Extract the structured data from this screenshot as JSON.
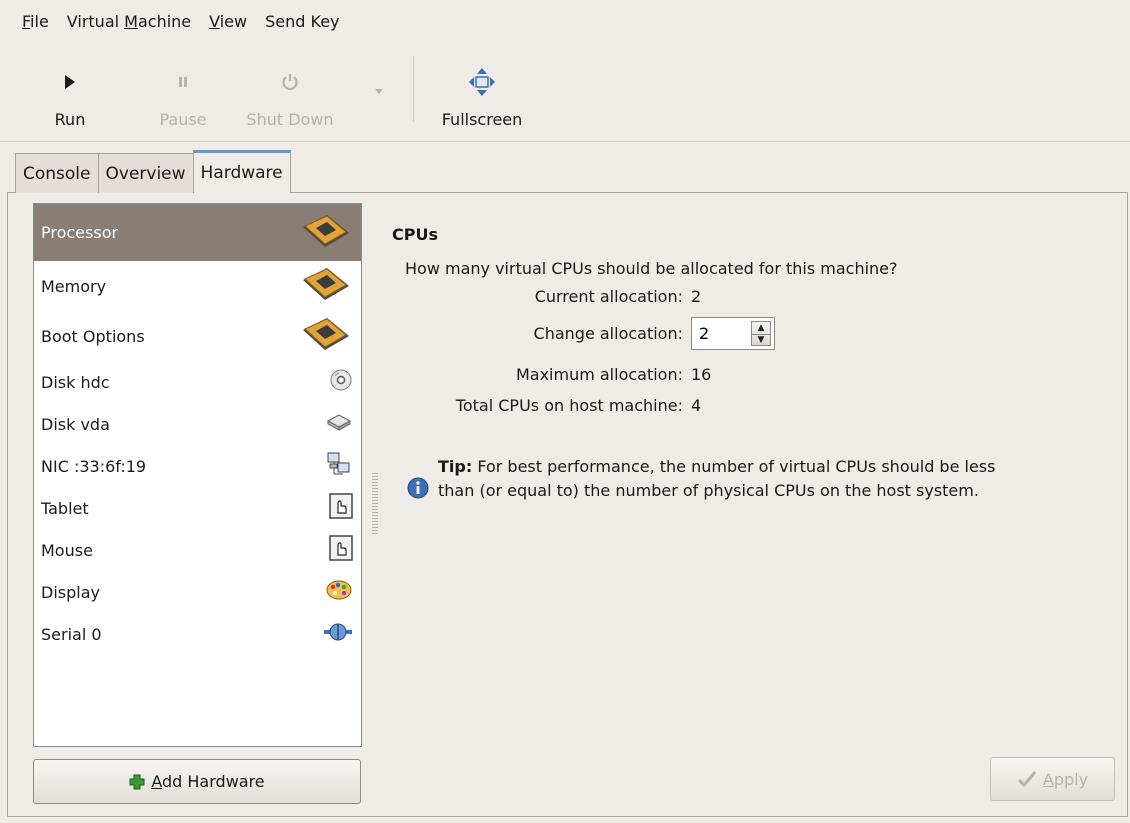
{
  "menu": [
    {
      "pre": "",
      "u": "F",
      "post": "ile"
    },
    {
      "pre": "Virtual ",
      "u": "M",
      "post": "achine"
    },
    {
      "pre": "",
      "u": "V",
      "post": "iew"
    },
    {
      "pre": "Send Key",
      "u": "",
      "post": ""
    }
  ],
  "toolbar": {
    "run": "Run",
    "pause": "Pause",
    "shutdown": "Shut Down",
    "fullscreen": "Fullscreen"
  },
  "tabs": [
    "Console",
    "Overview",
    "Hardware"
  ],
  "hardware_list": [
    {
      "label": "Processor",
      "icon": "chip-icon"
    },
    {
      "label": "Memory",
      "icon": "chip-icon"
    },
    {
      "label": "Boot Options",
      "icon": "chip-icon"
    },
    {
      "label": "Disk hdc",
      "icon": "cdrom-icon"
    },
    {
      "label": "Disk vda",
      "icon": "harddisk-icon"
    },
    {
      "label": "NIC :33:6f:19",
      "icon": "network-icon"
    },
    {
      "label": "Tablet",
      "icon": "tablet-icon"
    },
    {
      "label": "Mouse",
      "icon": "mouse-icon"
    },
    {
      "label": "Display",
      "icon": "palette-icon"
    },
    {
      "label": "Serial 0",
      "icon": "serial-icon"
    }
  ],
  "cpu": {
    "section_title": "CPUs",
    "question": "How many virtual CPUs should be allocated for this machine?",
    "current_label": "Current allocation:",
    "current_value": "2",
    "change_label": "Change allocation:",
    "change_value": "2",
    "max_label": "Maximum allocation:",
    "max_value": "16",
    "total_label": "Total CPUs on host machine:",
    "total_value": "4",
    "tip_bold": "Tip:",
    "tip_text": " For best performance, the number of virtual CPUs should be less than (or equal to) the number of physical CPUs on the host system."
  },
  "buttons": {
    "add_hardware_u": "A",
    "add_hardware_rest": "dd Hardware",
    "apply_u": "A",
    "apply_rest": "pply"
  },
  "colors": {
    "selection": "#8a7e74",
    "tab_accent": "#6e94c7",
    "add_icon": "#3a9a2f",
    "info_icon": "#3b6fb6"
  }
}
